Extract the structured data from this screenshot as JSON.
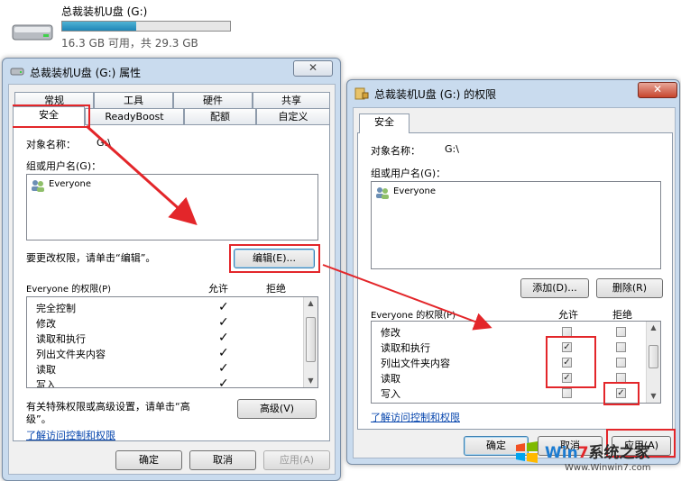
{
  "drive": {
    "name": "总裁装机U盘 (G:)",
    "capacity": "16.3 GB 可用，共 29.3 GB",
    "used_fraction": 0.44
  },
  "props_window": {
    "title": "总裁装机U盘 (G:) 属性",
    "close_label": "✕",
    "tabs_row1": [
      "常规",
      "工具",
      "硬件",
      "共享"
    ],
    "tabs_row2": [
      "安全",
      "ReadyBoost",
      "配额",
      "自定义"
    ],
    "object_label": "对象名称：",
    "object_value": "G:\\",
    "group_label": "组或用户名(G)：",
    "users": [
      "Everyone"
    ],
    "edit_hint": "要更改权限，请单击“编辑”。",
    "edit_button": "编辑(E)...",
    "perm_label": "Everyone 的权限(P)",
    "allow_header": "允许",
    "deny_header": "拒绝",
    "permissions": [
      {
        "name": "完全控制",
        "allow": true
      },
      {
        "name": "修改",
        "allow": true
      },
      {
        "name": "读取和执行",
        "allow": true
      },
      {
        "name": "列出文件夹内容",
        "allow": true
      },
      {
        "name": "读取",
        "allow": true
      },
      {
        "name": "写入",
        "allow": true
      }
    ],
    "special_hint_1": "有关特殊权限或高级设置，请单击“高",
    "special_hint_2": "级”。",
    "advanced_button": "高级(V)",
    "link_text": "了解访问控制和权限",
    "ok_button": "确定",
    "cancel_button": "取消",
    "apply_button": "应用(A)"
  },
  "perm_window": {
    "title": "总裁装机U盘 (G:) 的权限",
    "close_label": "✕",
    "tab": "安全",
    "object_label": "对象名称：",
    "object_value": "G:\\",
    "group_label": "组或用户名(G)：",
    "users": [
      "Everyone"
    ],
    "add_button": "添加(D)...",
    "remove_button": "删除(R)",
    "perm_label": "Everyone 的权限(P)",
    "allow_header": "允许",
    "deny_header": "拒绝",
    "permissions": [
      {
        "name": "修改",
        "allow": false,
        "deny": false
      },
      {
        "name": "读取和执行",
        "allow": true,
        "deny": false
      },
      {
        "name": "列出文件夹内容",
        "allow": true,
        "deny": false
      },
      {
        "name": "读取",
        "allow": true,
        "deny": false
      },
      {
        "name": "写入",
        "allow": false,
        "deny": true
      }
    ],
    "link_text": "了解访问控制和权限",
    "ok_button": "确定",
    "cancel_button": "取消",
    "apply_button": "应用(A)"
  },
  "watermark": {
    "brand_1": "Win",
    "brand_2": "7",
    "brand_3": "系统之家",
    "url": "Www.Winwin7.com"
  },
  "colors": {
    "annotation_red": "#e3262a",
    "window_frame": "#c9dbee",
    "link": "#0645ad"
  }
}
